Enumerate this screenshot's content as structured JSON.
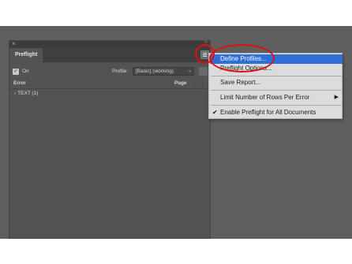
{
  "panel": {
    "tab_title": "Preflight",
    "close_glyph": "×",
    "grip_glyph": "»",
    "on_checkbox": {
      "checked": true,
      "label": "On"
    },
    "profile_label": "Profile:",
    "profile_value": "[Basic] (working)",
    "columns": {
      "error": "Error",
      "page": "Page"
    },
    "rows": [
      {
        "label": "TEXT (1)",
        "expanded": false
      }
    ]
  },
  "flyout_menu": {
    "items": [
      {
        "label": "Define Profiles...",
        "highlighted": true
      },
      {
        "label": "Preflight Options..."
      },
      {
        "label": "Save Report..."
      },
      {
        "label": "Limit Number of Rows Per Error",
        "submenu": true
      },
      {
        "label": "Enable Preflight for All Documents",
        "checked": true
      }
    ]
  },
  "icons": {
    "panel_menu": "hamburger-icon",
    "submenu_arrow": "▶",
    "checkmark": "✔",
    "tree_arrow": "›",
    "select_arrow": "⌄"
  },
  "colors": {
    "app_background": "#5f5f5f",
    "panel_background": "#535353",
    "menu_background": "#dcdcdc",
    "menu_highlight": "#2f6fd8",
    "annotation": "#e01010"
  }
}
